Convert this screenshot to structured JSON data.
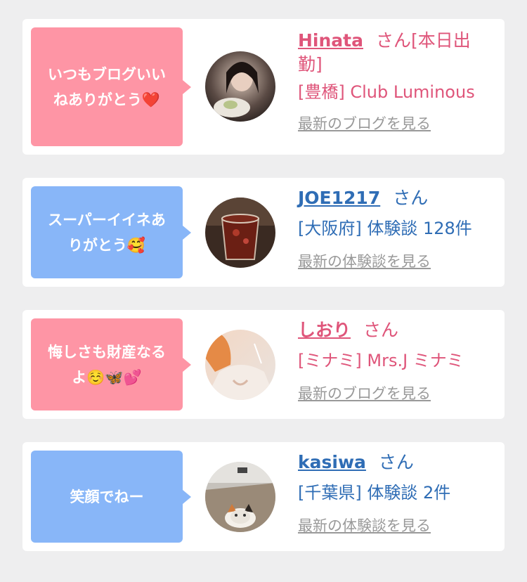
{
  "cards": [
    {
      "message": "いつもブログいい\nねありがとう❤️",
      "name": "Hinata",
      "honorific": "さん[本日出\n勤]",
      "location": "[豊橋]",
      "shop": "Club Luminous",
      "link": "最新のブログを見る",
      "accent": "#df557a",
      "bubble_color": "#fe95a5"
    },
    {
      "message": "スーパーイイネあ\nりがとう🥰",
      "name": "JOE1217",
      "honorific": "さん",
      "location": "[大阪府]",
      "shop": "体験談 128件",
      "link": "最新の体験談を見る",
      "accent": "#2f6db5",
      "bubble_color": "#88b6f8"
    },
    {
      "message": "悔しさも財産なる\nよ☺️🦋💕",
      "name": "しおり",
      "honorific": "さん",
      "location": "[ミナミ]",
      "shop": "Mrs.J ミナミ",
      "link": "最新のブログを見る",
      "accent": "#df557a",
      "bubble_color": "#fe95a5"
    },
    {
      "message": "笑顔でねー",
      "name": "kasiwa",
      "honorific": "さん",
      "location": "[千葉県]",
      "shop": "体験談 2件",
      "link": "最新の体験談を見る",
      "accent": "#2f6db5",
      "bubble_color": "#88b6f8"
    }
  ]
}
